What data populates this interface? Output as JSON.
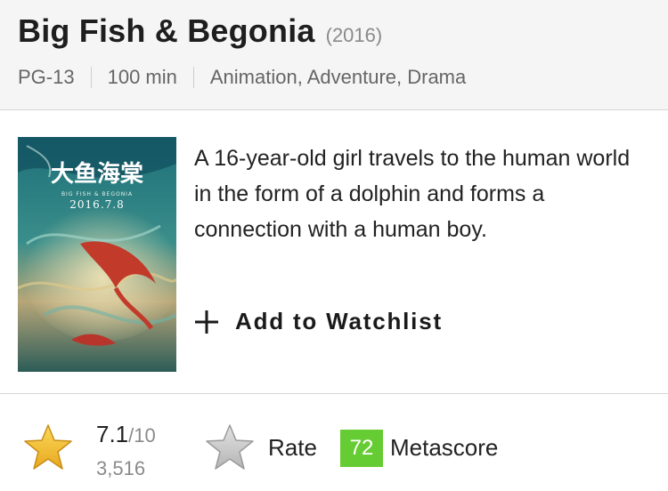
{
  "movie": {
    "title": "Big Fish & Begonia",
    "year": "(2016)",
    "rating_cert": "PG-13",
    "runtime": "100 min",
    "genres": "Animation, Adventure, Drama"
  },
  "poster": {
    "title_cn": "大鱼海棠",
    "subtitle": "BIG FISH & BEGONIA",
    "date": "2016.7.8"
  },
  "plot": "A 16-year-old girl travels to the human world in the form of a dolphin and forms a connection with a human boy.",
  "actions": {
    "watchlist_label": "Add to Watchlist"
  },
  "ratings": {
    "user_rating": "7.1",
    "out_of": "/10",
    "votes": "3,516",
    "rate_label": "Rate",
    "metascore": "72",
    "metascore_label": "Metascore"
  },
  "colors": {
    "star_gold": "#f5c518",
    "metascore_green": "#66cc33"
  }
}
